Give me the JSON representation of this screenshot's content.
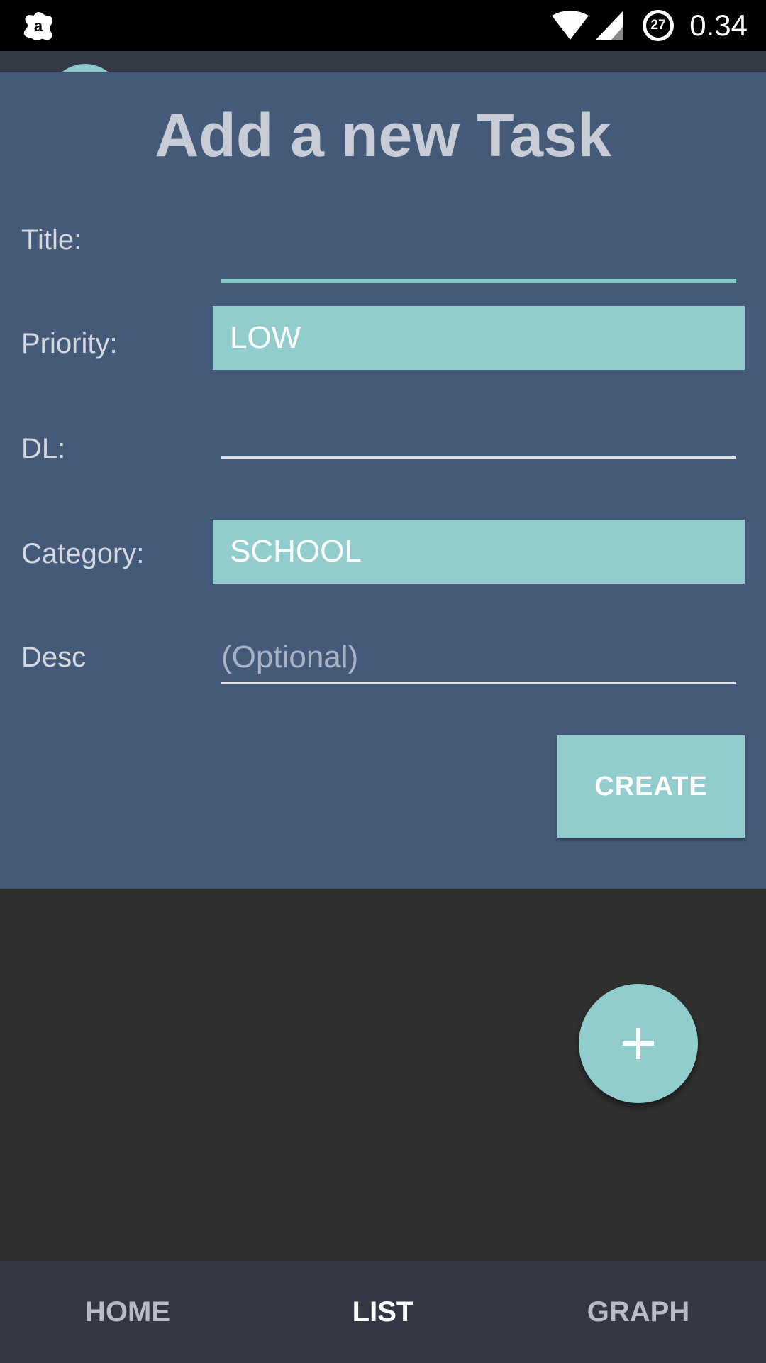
{
  "status_bar": {
    "time": "0.34",
    "battery_level": "27",
    "left_icon": "avast-icon",
    "icons": [
      "wifi-icon",
      "cell-signal-icon",
      "battery-icon"
    ]
  },
  "dialog": {
    "title": "Add a new Task",
    "fields": {
      "title_label": "Title:",
      "title_value": "",
      "priority_label": "Priority:",
      "priority_value": "LOW",
      "dl_label": "DL:",
      "dl_value": "",
      "category_label": "Category:",
      "category_value": "SCHOOL",
      "desc_label": "Desc",
      "desc_placeholder": "(Optional)"
    },
    "create_label": "CREATE"
  },
  "fab": {
    "icon": "plus-icon"
  },
  "bottom_nav": {
    "tabs": [
      {
        "label": "HOME",
        "active": false
      },
      {
        "label": "LIST",
        "active": true
      },
      {
        "label": "GRAPH",
        "active": false
      }
    ]
  },
  "colors": {
    "dialog_bg": "#455a78",
    "accent": "#92cdce",
    "focus_line": "#7ecbc4",
    "background": "#303030",
    "nav_bg": "#333743"
  }
}
